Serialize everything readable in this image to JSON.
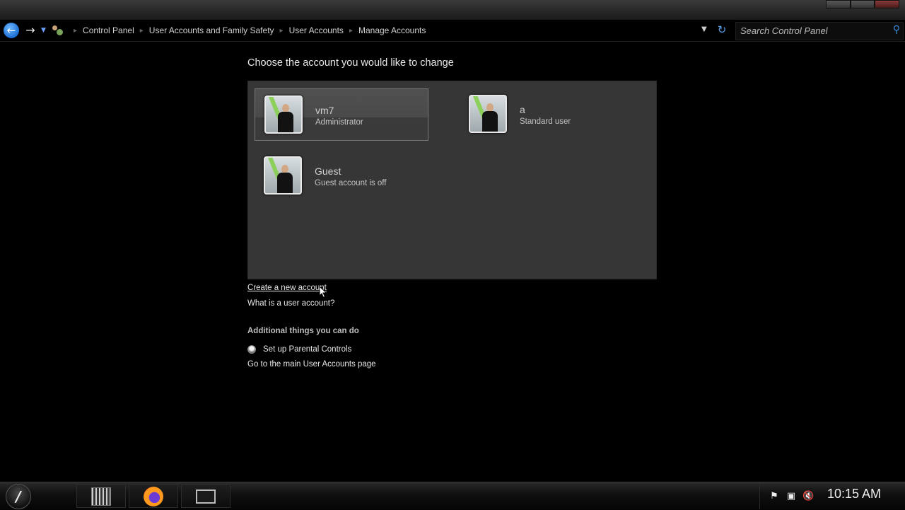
{
  "navigation": {
    "breadcrumbs": [
      "Control Panel",
      "User Accounts and Family Safety",
      "User Accounts",
      "Manage Accounts"
    ]
  },
  "search": {
    "placeholder": "Search Control Panel"
  },
  "main": {
    "heading": "Choose the account you would like to change",
    "accounts": [
      {
        "name": "vm7",
        "role": "Administrator",
        "selected": true
      },
      {
        "name": "a",
        "role": "Standard user",
        "selected": false
      },
      {
        "name": "Guest",
        "role": "Guest account is off",
        "selected": false
      }
    ],
    "links": {
      "create": "Create a new account",
      "what_is": "What is a user account?"
    },
    "additional": {
      "title": "Additional things you can do",
      "parental": "Set up Parental Controls",
      "main_page": "Go to the main User Accounts page"
    }
  },
  "taskbar": {
    "items": [
      "files-icon",
      "firefox-icon",
      "command-prompt-icon"
    ],
    "clock": "10:15 AM"
  }
}
